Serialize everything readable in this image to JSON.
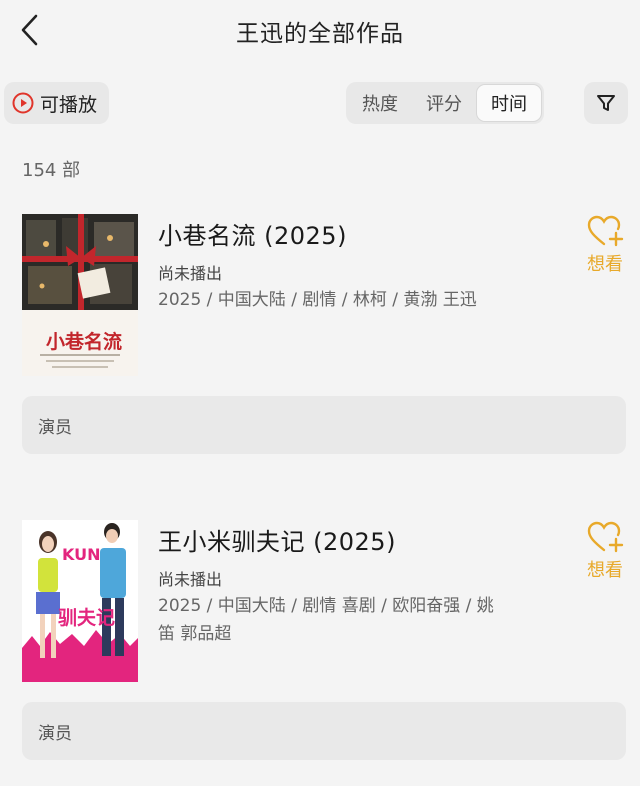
{
  "header": {
    "title": "王迅的全部作品"
  },
  "toolbar": {
    "playable_label": "可播放",
    "sort_tabs": [
      "热度",
      "评分",
      "时间"
    ],
    "active_sort": "时间"
  },
  "count_label": "154 部",
  "items": [
    {
      "title": "小巷名流 (2025)",
      "status": "尚未播出",
      "meta": "2025 / 中国大陆 / 剧情 / 林柯 / 黄渤 王迅",
      "want_label": "想看",
      "cast_label": "演员",
      "poster_text": "小巷名流"
    },
    {
      "title": "王小米驯夫记 (2025)",
      "status": "尚未播出",
      "meta": "2025 / 中国大陆 / 剧情 喜剧 / 欧阳奋强 / 姚笛 郭品超",
      "want_label": "想看",
      "cast_label": "演员",
      "poster_text": "驯夫记"
    }
  ],
  "colors": {
    "accent": "#e8a92a",
    "play_red": "#e0352b",
    "background": "#f4f4f4"
  }
}
